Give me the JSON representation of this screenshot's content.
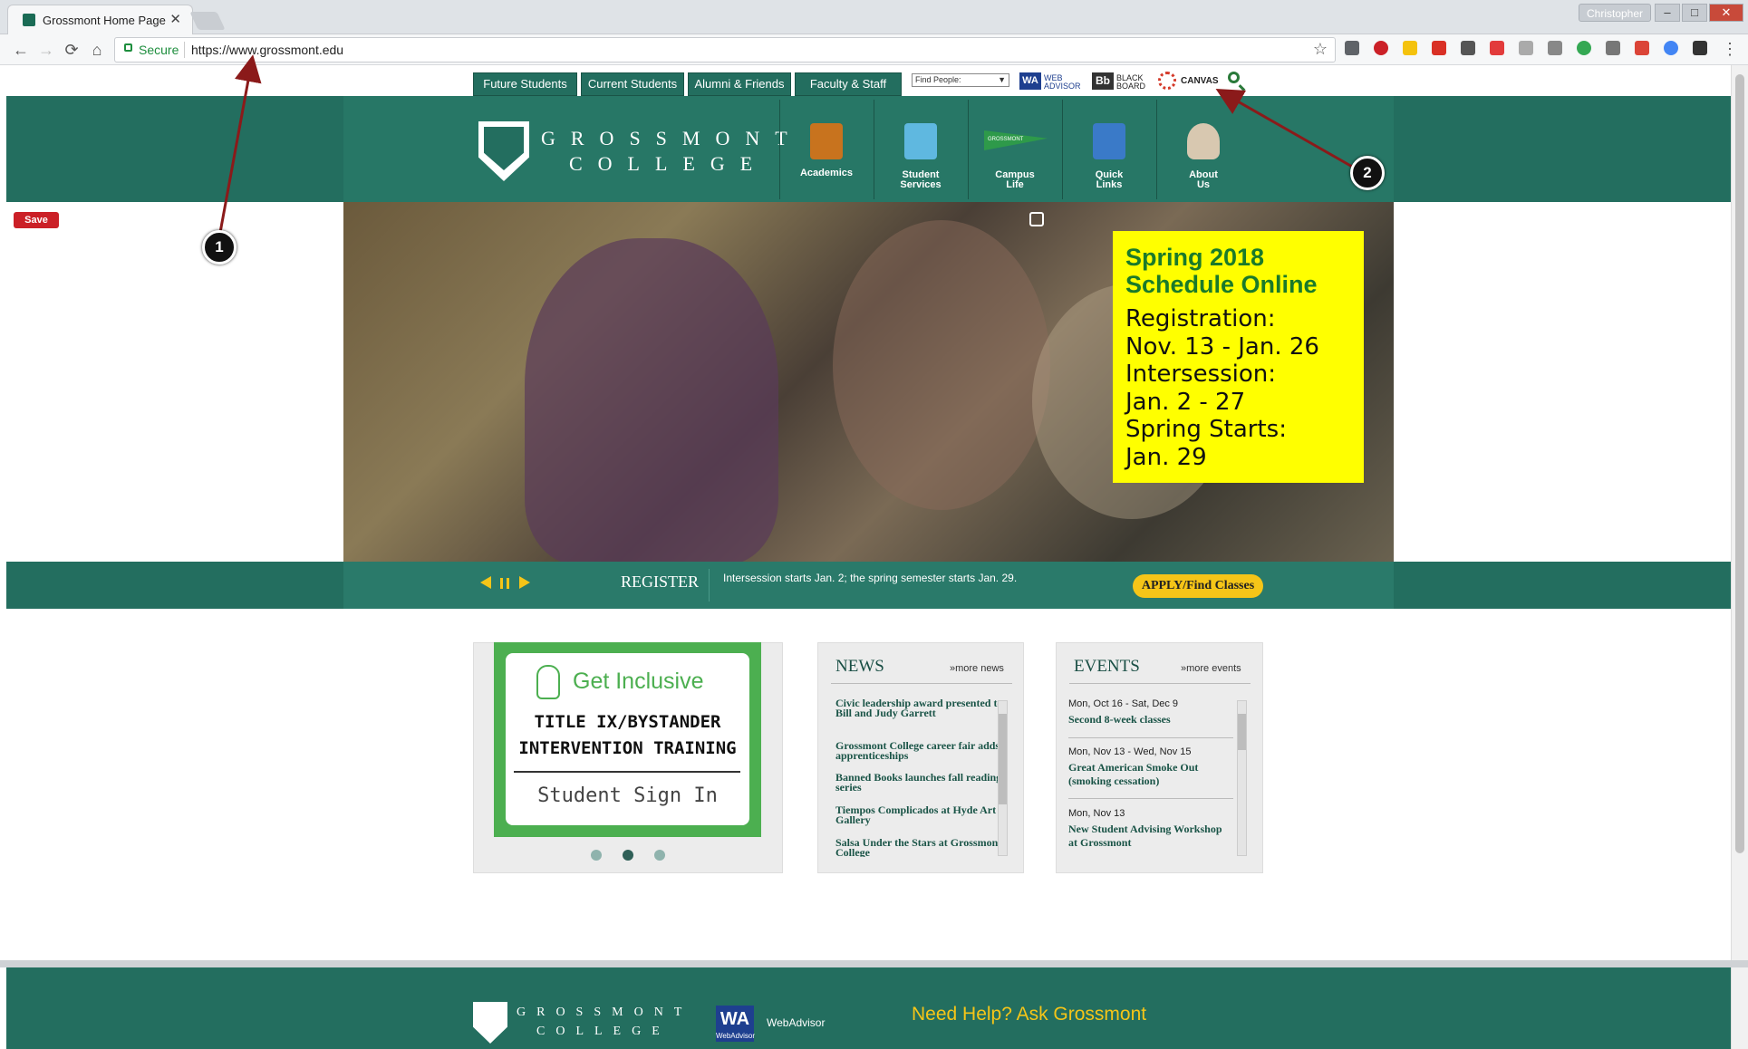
{
  "browser": {
    "tab_title": "Grossmont Home Page",
    "tab_close": "✕",
    "profile_name": "Christopher",
    "secure_label": "Secure",
    "url": "https://www.grossmont.edu",
    "buttons": {
      "back": "←",
      "forward": "→",
      "reload": "⟳",
      "home": "⌂",
      "bookmark": "☆",
      "minimize": "–",
      "maximize": "□",
      "close": "✕"
    }
  },
  "topnav": {
    "tabs": [
      {
        "label": "Future Students"
      },
      {
        "label": "Current Students"
      },
      {
        "label": "Alumni & Friends"
      },
      {
        "label": "Faculty & Staff"
      }
    ],
    "find_people": "Find People:",
    "webadvisor_abbr": "WA",
    "webadvisor_line1": "WEB",
    "webadvisor_line2": "ADVISOR",
    "blackboard_abbr": "Bb",
    "blackboard_line1": "BLACK",
    "blackboard_line2": "BOARD",
    "canvas_label": "CANVAS"
  },
  "header": {
    "logo_line1": "GROSSMONT",
    "logo_line2": "COLLEGE",
    "nav": [
      {
        "line1": "Academics",
        "line2": ""
      },
      {
        "line1": "Student",
        "line2": "Services"
      },
      {
        "line1": "Campus",
        "line2": "Life"
      },
      {
        "line1": "Quick",
        "line2": "Links"
      },
      {
        "line1": "About",
        "line2": "Us"
      }
    ],
    "pennant_text": "GROSSMONT"
  },
  "pinterest_save": "Save",
  "hero": {
    "promo_title": "Spring 2018 Schedule Online",
    "promo_body": "Registration:\nNov. 13 - Jan. 26\nIntersession:\nJan. 2 - 27\nSpring Starts:\nJan. 29"
  },
  "heroband": {
    "register_label": "REGISTER",
    "message": "Intersession starts Jan. 2; the spring semester starts Jan. 29.",
    "apply_label": "APPLY/Find Classes"
  },
  "inclusive": {
    "title": "Get Inclusive",
    "line1": "TITLE IX/BYSTANDER",
    "line2": "INTERVENTION TRAINING",
    "signin": "Student Sign In"
  },
  "news": {
    "heading": "NEWS",
    "more": "»more news",
    "items": [
      {
        "title": "Civic leadership award presented to Bill and Judy Garrett"
      },
      {
        "title": "Grossmont College career fair adds apprenticeships"
      },
      {
        "title": "Banned Books launches fall reading series"
      },
      {
        "title": "Tiempos Complicados at Hyde Art Gallery"
      },
      {
        "title": "Salsa Under the Stars at Grossmont College"
      }
    ]
  },
  "events": {
    "heading": "EVENTS",
    "more": "»more events",
    "items": [
      {
        "date": "Mon, Oct 16 - Sat, Dec 9",
        "title": "Second 8-week classes"
      },
      {
        "date": "Mon, Nov 13 - Wed, Nov 15",
        "title": "Great American Smoke Out (smoking cessation)"
      },
      {
        "date": "Mon, Nov 13",
        "title": "New Student Advising Workshop at Grossmont"
      }
    ]
  },
  "footer": {
    "logo_line1": "GROSSMONT",
    "logo_line2": "COLLEGE",
    "webadvisor_abbr": "WA",
    "webadvisor_small": "WebAdvisor",
    "webadvisor_label": "WebAdvisor",
    "help": "Need Help? Ask Grossmont"
  },
  "annotations": [
    {
      "label": "1"
    },
    {
      "label": "2"
    }
  ],
  "colors": {
    "brand_green": "#236e5f",
    "accent_yellow": "#f5c518",
    "promo_yellow": "#ffff00",
    "annotation_arrow": "#8b1a1a"
  }
}
